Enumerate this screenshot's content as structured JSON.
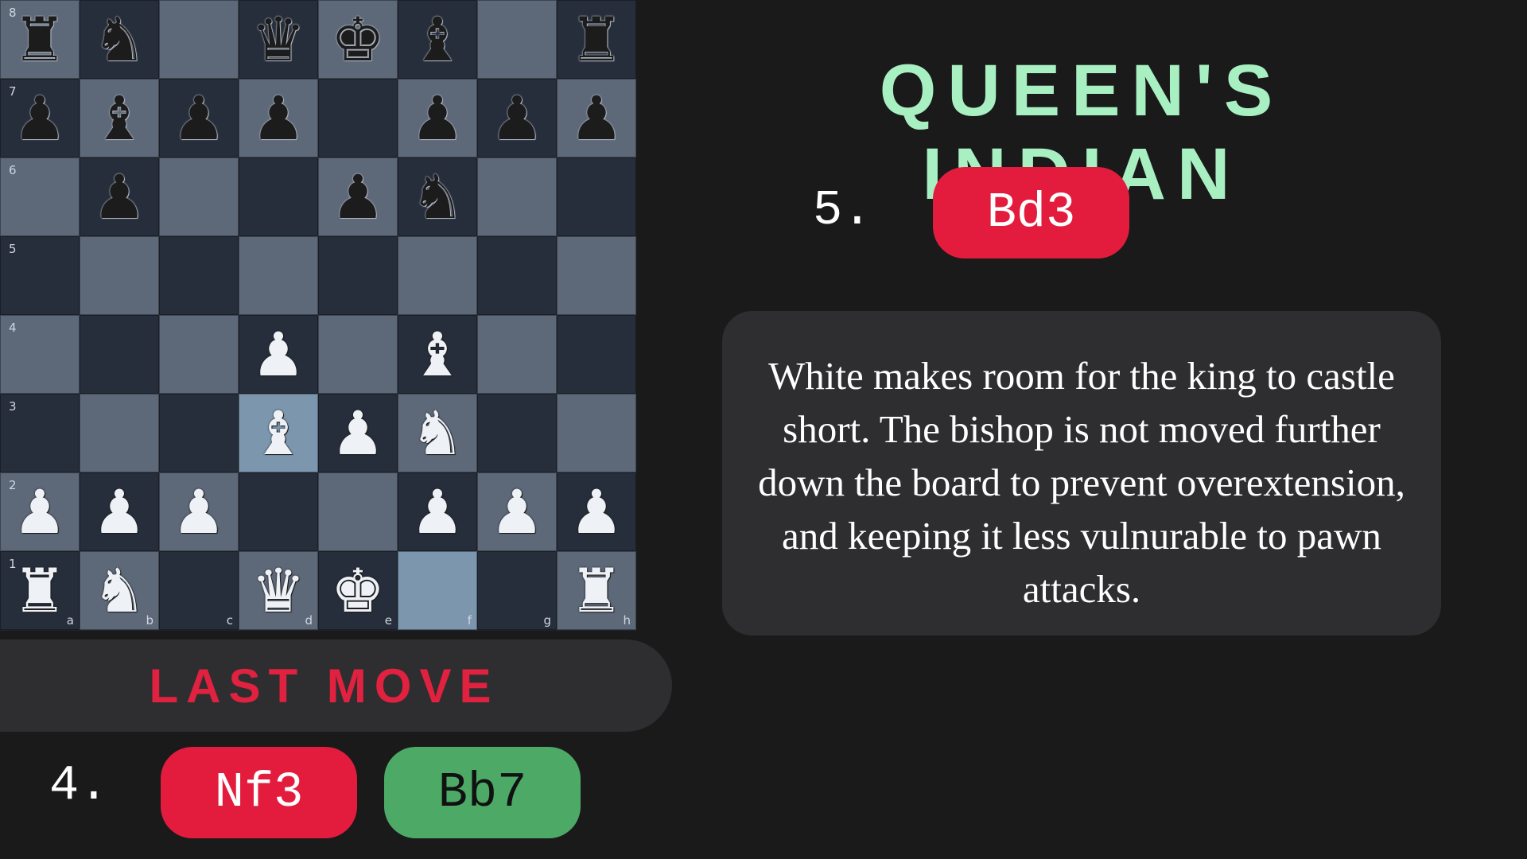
{
  "board": {
    "ranks": [
      "8",
      "7",
      "6",
      "5",
      "4",
      "3",
      "2",
      "1"
    ],
    "files": [
      "a",
      "b",
      "c",
      "d",
      "e",
      "f",
      "g",
      "h"
    ],
    "rows": [
      [
        "r",
        "n",
        "",
        "q",
        "k",
        "b",
        "",
        "r"
      ],
      [
        "p",
        "b",
        "p",
        "p",
        "",
        "p",
        "p",
        "p"
      ],
      [
        "",
        "p",
        "",
        "",
        "p",
        "n",
        "",
        ""
      ],
      [
        "",
        "",
        "",
        "",
        "",
        "",
        "",
        ""
      ],
      [
        "",
        "",
        "",
        "P",
        "",
        "B",
        "",
        ""
      ],
      [
        "",
        "",
        "",
        "B",
        "P",
        "N",
        "",
        ""
      ],
      [
        "P",
        "P",
        "P",
        "",
        "",
        "P",
        "P",
        "P"
      ],
      [
        "R",
        "N",
        "",
        "Q",
        "K",
        "",
        "",
        "R"
      ]
    ],
    "highlighted": [
      "d3",
      "f1"
    ],
    "colors": {
      "light": "#5d6878",
      "dark": "#272e3b",
      "highlight": "#7c96ad"
    }
  },
  "opening": {
    "title": "QUEEN'S INDIAN"
  },
  "current_move": {
    "number": "5.",
    "white": "Bd3"
  },
  "explanation": "White makes room for the king to castle short. The bishop is not moved further down the board to prevent overextension, and keeping it less vulnurable to pawn attacks.",
  "last_move": {
    "label": "LAST MOVE",
    "number": "4.",
    "white": "Nf3",
    "black": "Bb7"
  },
  "colors": {
    "accent_red": "#e31c3d",
    "accent_green": "#4caa66",
    "title_green": "#a8f0c2",
    "panel": "#2e2e30",
    "background": "#1a1a1b"
  }
}
